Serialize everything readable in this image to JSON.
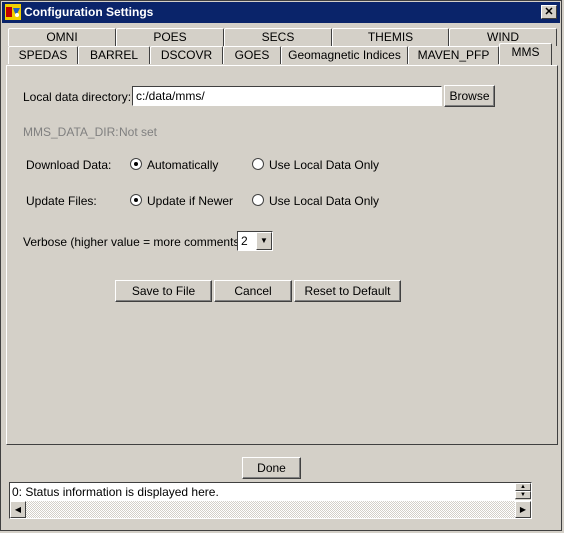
{
  "window": {
    "title": "Configuration Settings",
    "close_glyph": "✕"
  },
  "tabs_row1": [
    "OMNI",
    "POES",
    "SECS",
    "THEMIS",
    "WIND"
  ],
  "tabs_row2": [
    "SPEDAS",
    "BARREL",
    "DSCOVR",
    "GOES",
    "Geomagnetic Indices",
    "MAVEN_PFP",
    "MMS"
  ],
  "active_tab": "MMS",
  "mms": {
    "local_dir_label": "Local data directory:",
    "local_dir_value": "c:/data/mms/",
    "browse_label": "Browse",
    "env_label": "MMS_DATA_DIR:",
    "env_value": "Not set",
    "download_label": "Download Data:",
    "download_opt1": "Automatically",
    "download_opt2": "Use Local Data Only",
    "download_selected": "Automatically",
    "update_label": "Update Files:",
    "update_opt1": "Update if Newer",
    "update_opt2": "Use Local Data Only",
    "update_selected": "Update if Newer",
    "verbose_label": "Verbose (higher value = more comments):",
    "verbose_value": "2",
    "save_label": "Save to File",
    "cancel_label": "Cancel",
    "reset_label": "Reset to Default"
  },
  "done_label": "Done",
  "status_text": "0: Status information is displayed here.",
  "icons": {
    "app": "idl-app-icon",
    "close": "close-icon",
    "dropdown": "chevron-down-icon"
  }
}
